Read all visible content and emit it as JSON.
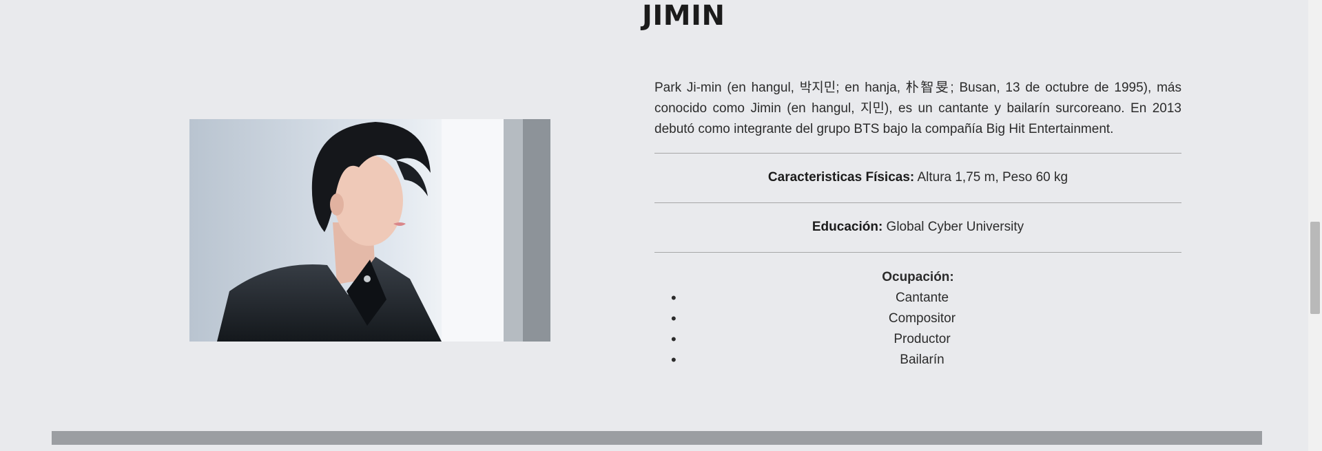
{
  "heading": {
    "title": "JIMIN"
  },
  "photo": {
    "alt": "Jimin photo"
  },
  "bio": {
    "text": "Park Ji-min (en hangul, 박지민; en hanja, 朴智旻; Busan, 13 de octubre de 1995), más conocido como Jimin (en hangul, 지민), es un cantante y bailarín surcoreano. En 2013 debutó como integrante del grupo BTS bajo la compañía Big Hit Entertainment."
  },
  "physical": {
    "label": "Caracteristicas Físicas:",
    "value": " Altura 1,75 m, Peso 60 kg"
  },
  "education": {
    "label": "Educación:",
    "value": " Global Cyber University"
  },
  "occupation": {
    "label": "Ocupación:",
    "items": [
      "Cantante",
      "Compositor",
      "Productor",
      "Bailarín"
    ]
  },
  "colors": {
    "background": "#e9eaed",
    "divider": "#a6a6a6",
    "footer_bar": "#9b9ea2"
  }
}
